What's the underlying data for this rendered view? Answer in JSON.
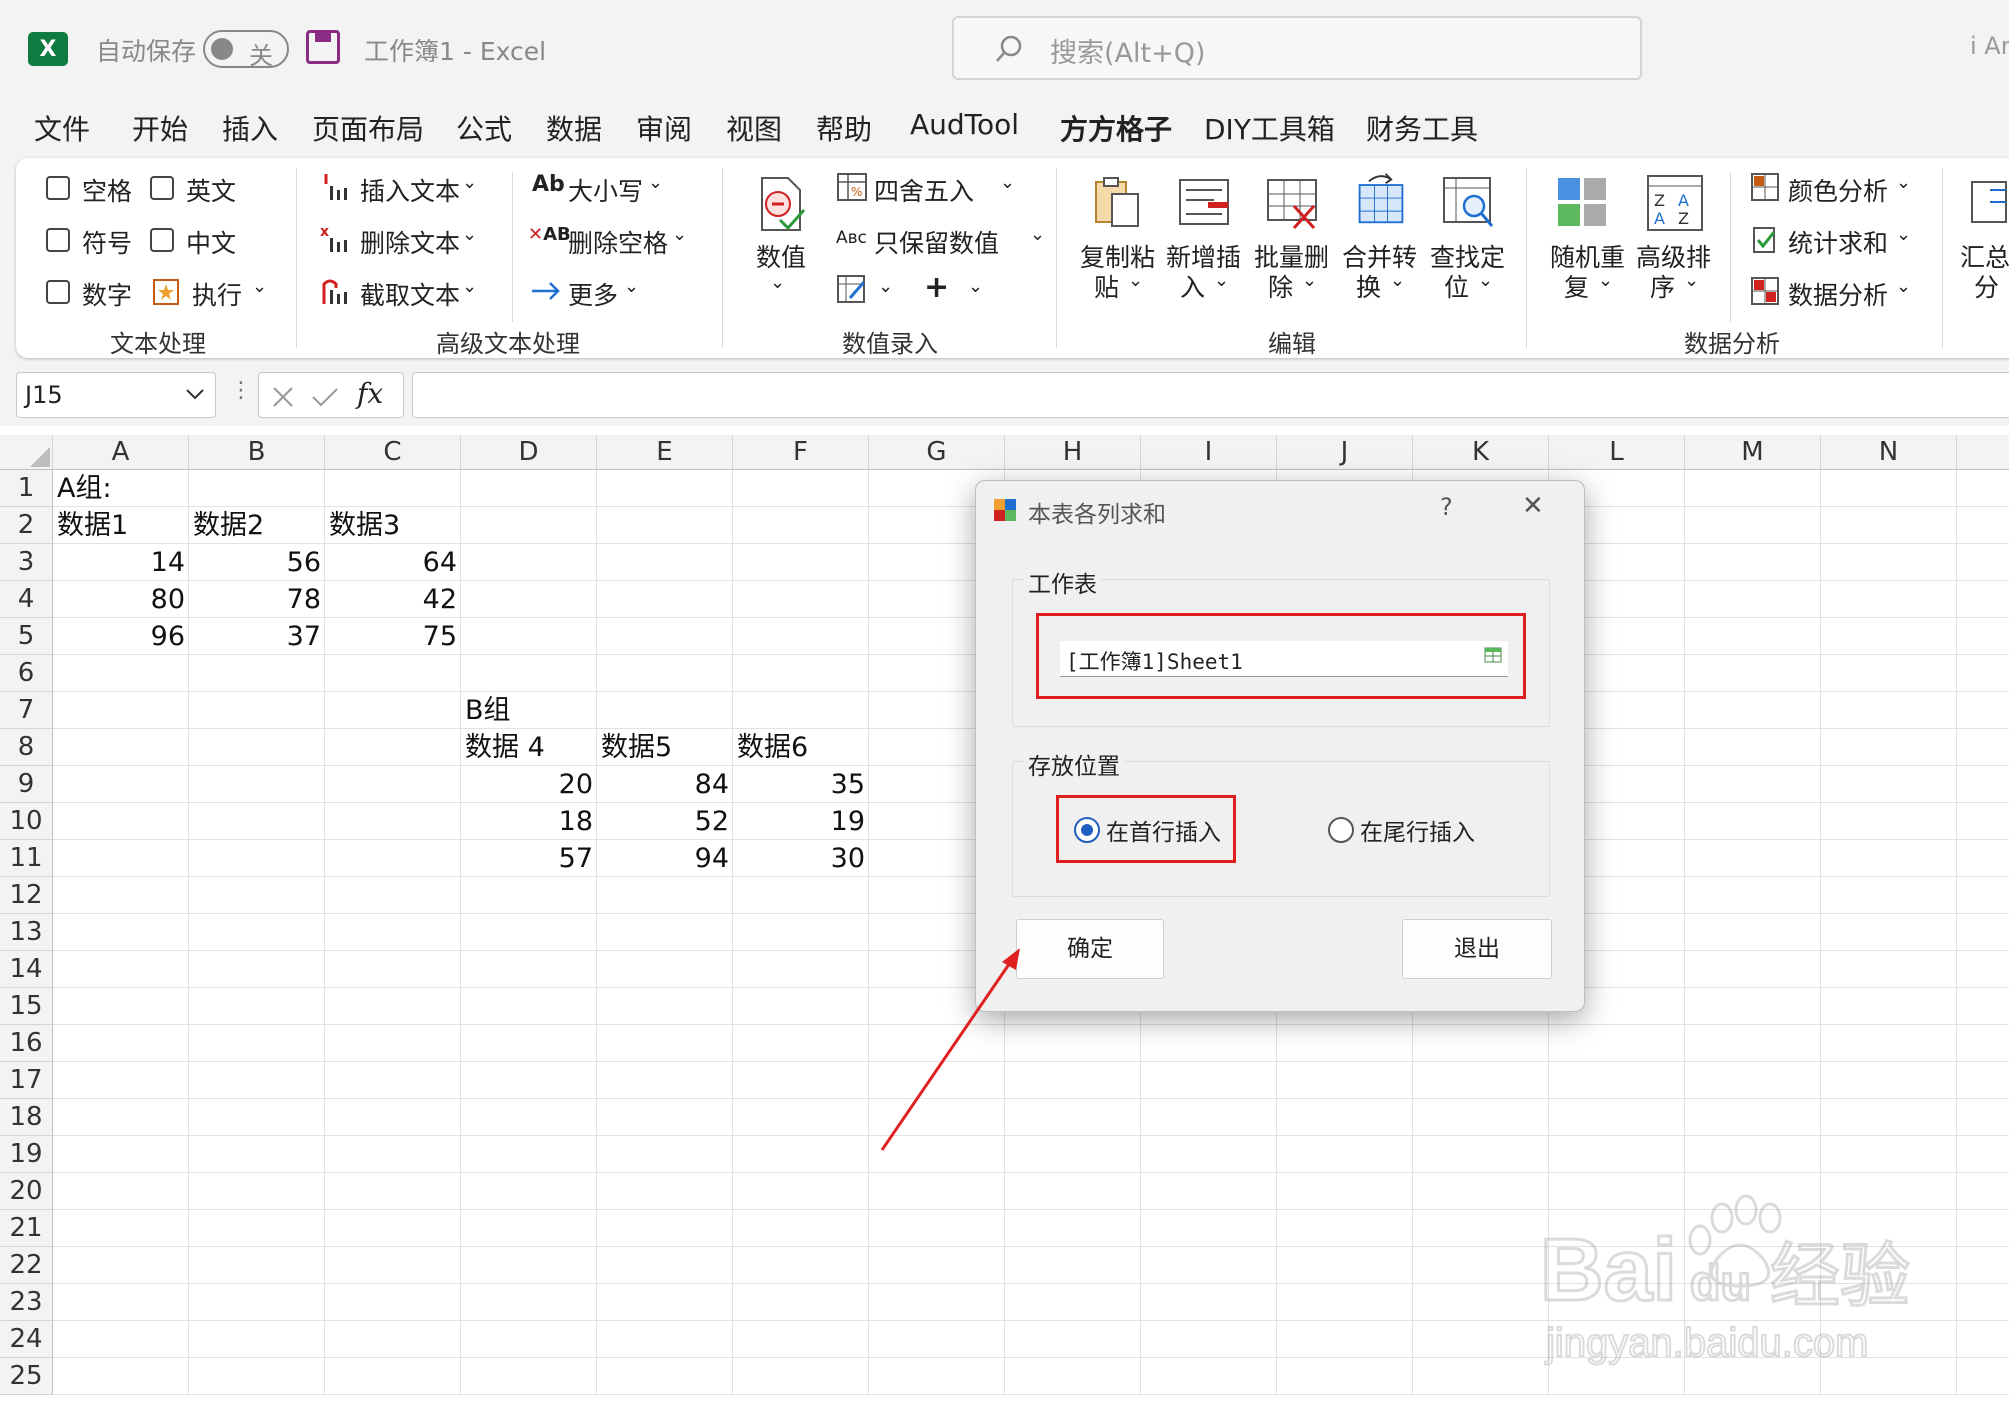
{
  "titlebar": {
    "autosave_label": "自动保存",
    "autosave_state": "关",
    "workbook_title": "工作簿1  -  Excel",
    "search_placeholder": "搜索(Alt+Q)",
    "user_partial": "i An"
  },
  "menu_tabs": [
    "文件",
    "开始",
    "插入",
    "页面布局",
    "公式",
    "数据",
    "审阅",
    "视图",
    "帮助",
    "AudTool",
    "方方格子",
    "DIY工具箱",
    "财务工具"
  ],
  "active_tab": "方方格子",
  "ribbon": {
    "text_process": {
      "label": "文本处理",
      "items": [
        "空格",
        "英文",
        "符号",
        "中文",
        "数字",
        "执行"
      ]
    },
    "adv_text": {
      "label": "高级文本处理",
      "items": [
        "插入文本",
        "删除文本",
        "截取文本",
        "大小写",
        "删除空格",
        "更多"
      ]
    },
    "num_entry": {
      "label": "数值录入",
      "big": "数值",
      "items": [
        "四舍五入",
        "只保留数值"
      ]
    },
    "edit": {
      "label": "编辑",
      "buttons": [
        [
          "复制粘",
          "贴"
        ],
        [
          "新增插",
          "入"
        ],
        [
          "批量删",
          "除"
        ],
        [
          "合并转",
          "换"
        ],
        [
          "查找定",
          "位"
        ]
      ]
    },
    "analysis": {
      "label": "数据分析",
      "buttons": [
        [
          "随机重",
          "复"
        ],
        [
          "高级排",
          "序"
        ]
      ],
      "items": [
        "颜色分析",
        "统计求和",
        "数据分析"
      ]
    },
    "partial": [
      "汇总",
      "分"
    ]
  },
  "formula_bar": {
    "name_box": "J15",
    "fx": "fx"
  },
  "sheet": {
    "columns": [
      "A",
      "B",
      "C",
      "D",
      "E",
      "F",
      "G",
      "H",
      "I",
      "J",
      "K",
      "L",
      "M",
      "N"
    ],
    "rows": [
      "1",
      "2",
      "3",
      "4",
      "5",
      "6",
      "7",
      "8",
      "9",
      "10",
      "11",
      "12",
      "13",
      "14",
      "15",
      "16",
      "17",
      "18",
      "19",
      "20",
      "21",
      "22",
      "23",
      "24",
      "25"
    ],
    "groupA": {
      "label": "A组:",
      "headers": [
        "数据1",
        "数据2",
        "数据3"
      ],
      "data": [
        [
          "14",
          "56",
          "64"
        ],
        [
          "80",
          "78",
          "42"
        ],
        [
          "96",
          "37",
          "75"
        ]
      ]
    },
    "groupB": {
      "label": "B组",
      "headers": [
        "数据 4",
        "数据5",
        "数据6"
      ],
      "data": [
        [
          "20",
          "84",
          "35"
        ],
        [
          "18",
          "52",
          "19"
        ],
        [
          "57",
          "94",
          "30"
        ]
      ]
    }
  },
  "dialog": {
    "title": "本表各列求和",
    "help": "?",
    "close": "✕",
    "worksheet_label": "工作表",
    "worksheet_value": "[工作簿1]Sheet1",
    "position_label": "存放位置",
    "option_first": "在首行插入",
    "option_last": "在尾行插入",
    "selected": "first",
    "ok": "确定",
    "exit": "退出"
  },
  "watermark": {
    "brand": "Bai",
    "brand2": "du",
    "brand_cn": "经验",
    "url": "jingyan.baidu.com"
  },
  "colors": {
    "excel_green": "#107c41",
    "highlight_red": "#e02020",
    "radio_blue": "#1f5fbf"
  }
}
